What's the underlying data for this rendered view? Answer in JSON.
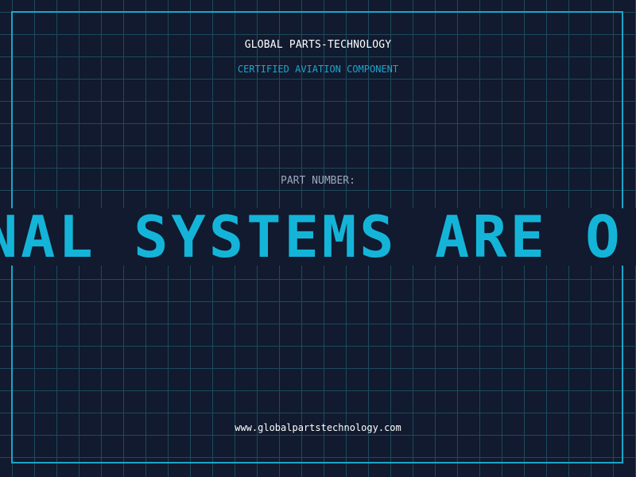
{
  "header": {
    "company": "GLOBAL PARTS-TECHNOLOGY",
    "subtitle": "CERTIFIED AVIATION COMPONENT"
  },
  "part": {
    "label": "PART NUMBER:",
    "marquee_text": "MINAL SYSTEMS ARE O"
  },
  "footer": {
    "website": "www.globalpartstechnology.com"
  },
  "colors": {
    "background": "#111a2e",
    "grid": "#1d4a5c",
    "accent": "#19a6c9",
    "text": "#ffffff"
  }
}
